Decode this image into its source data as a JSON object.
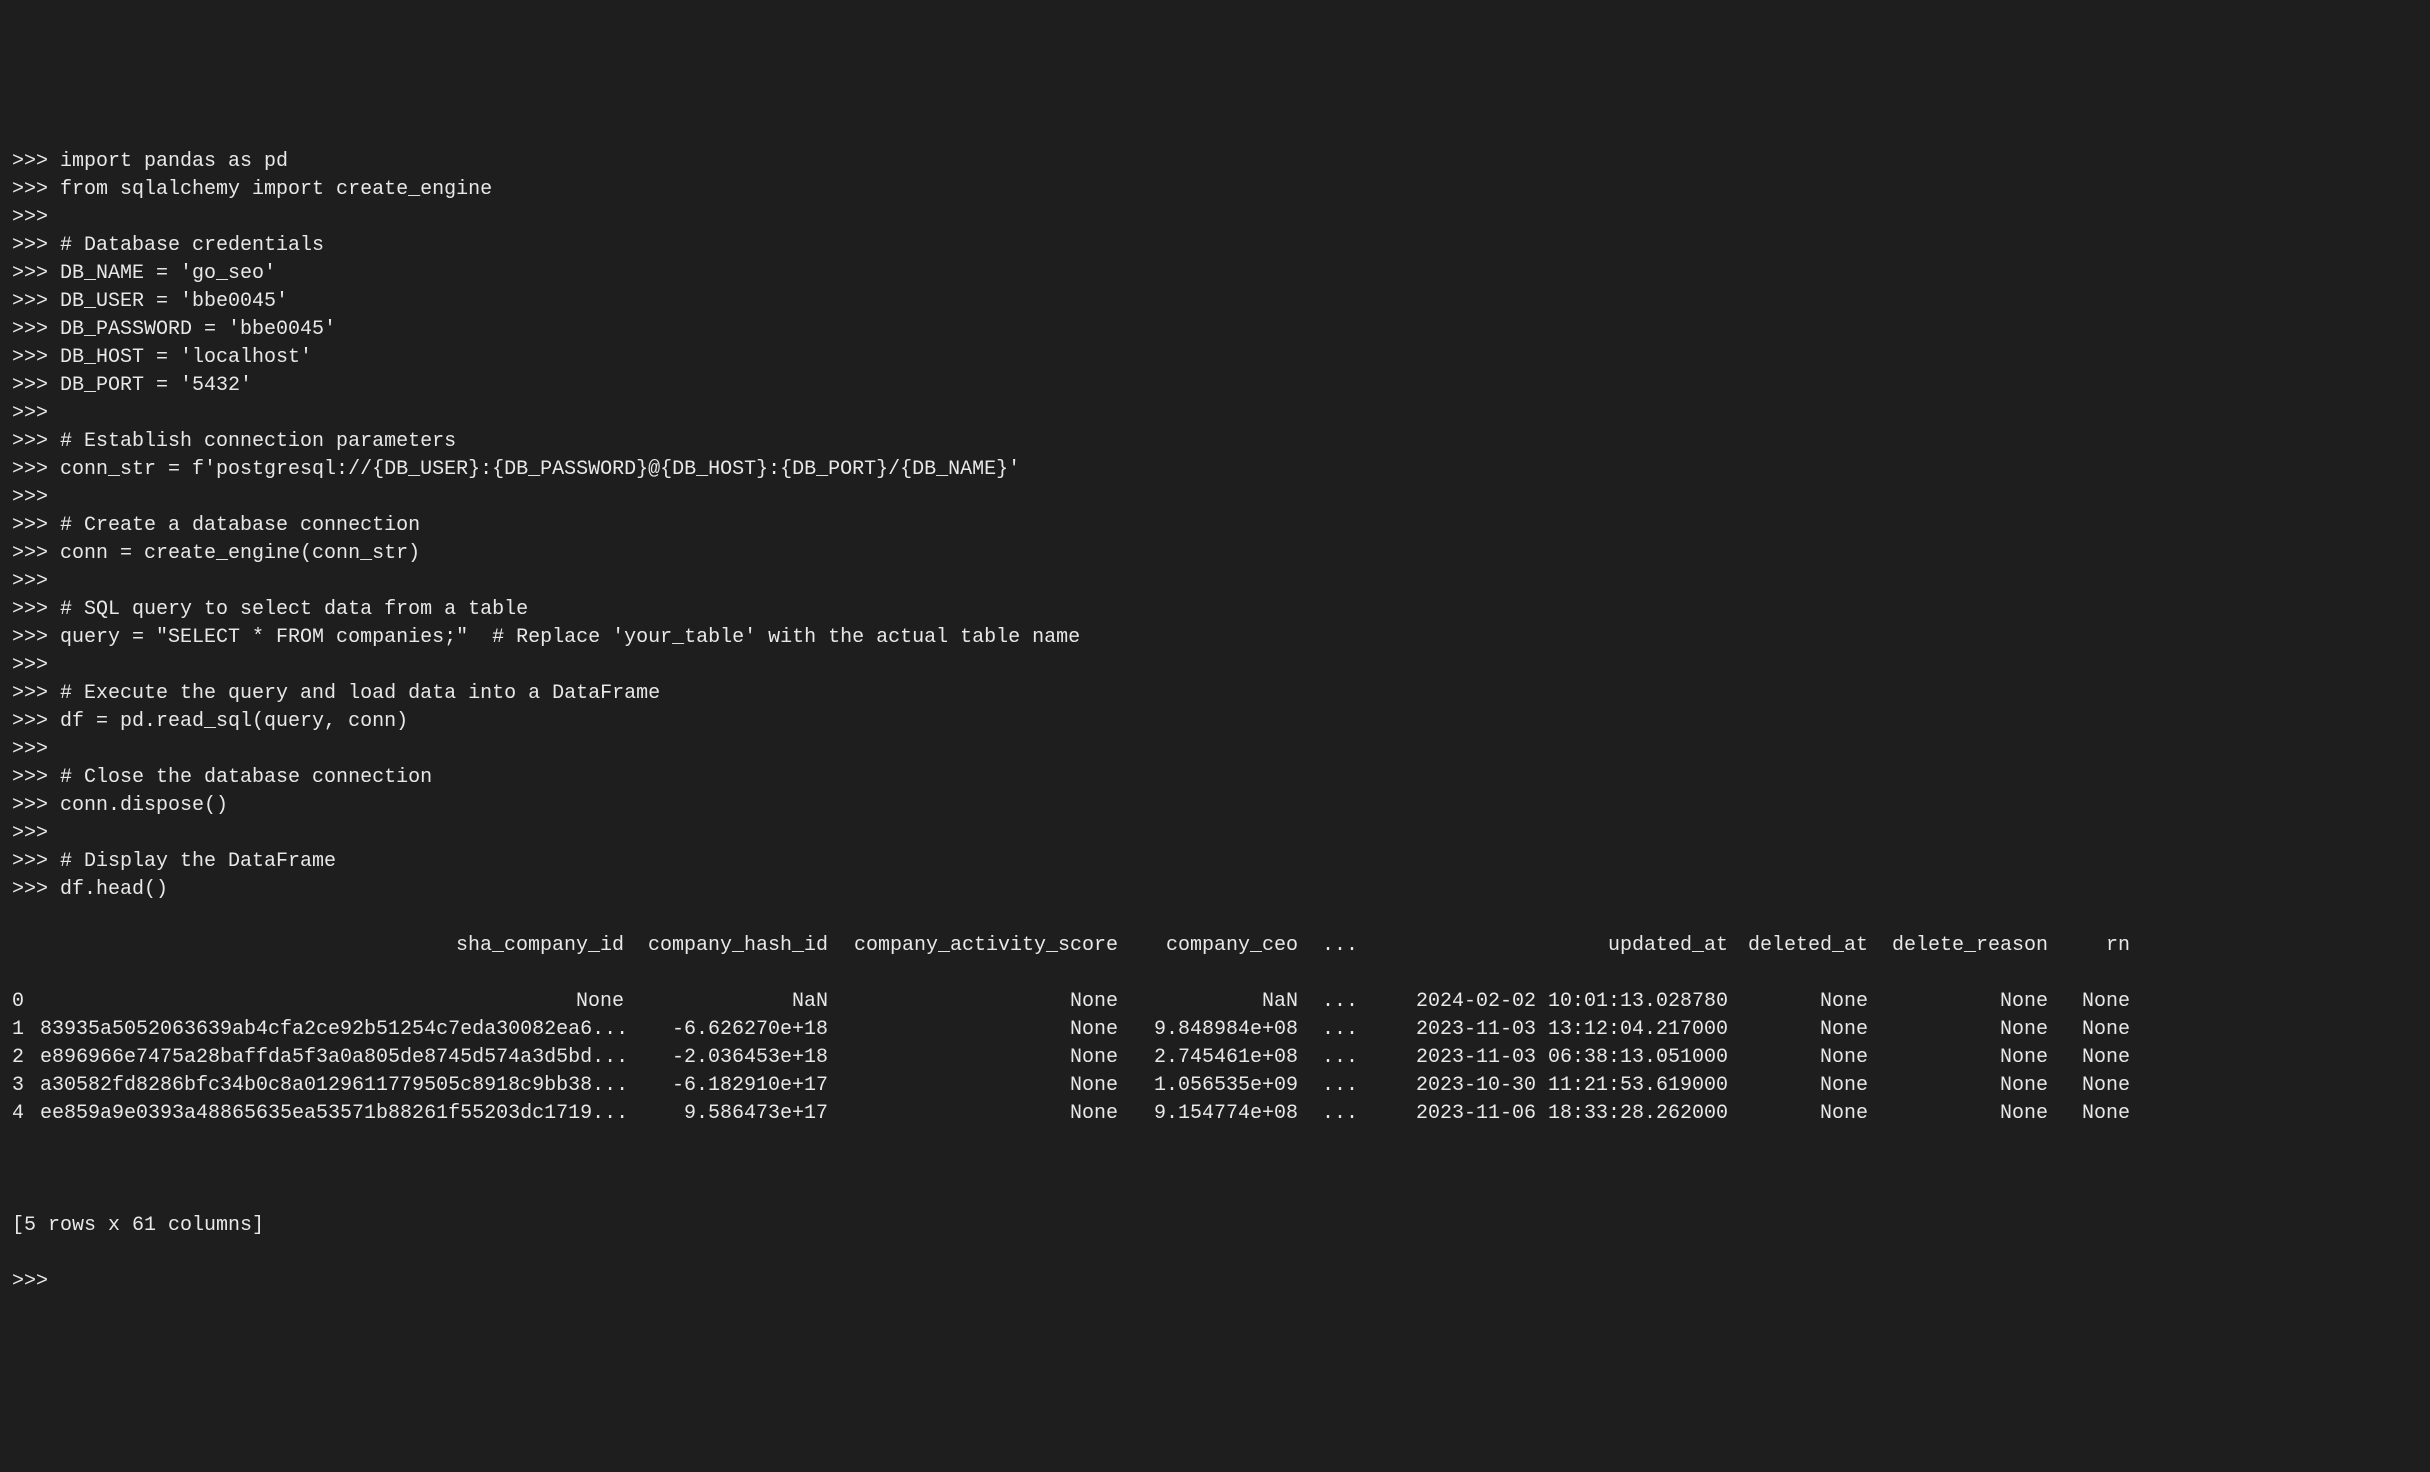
{
  "prompt": ">>> ",
  "code_lines": [
    "import pandas as pd",
    "from sqlalchemy import create_engine",
    "",
    "# Database credentials",
    "DB_NAME = 'go_seo'",
    "DB_USER = 'bbe0045'",
    "DB_PASSWORD = 'bbe0045'",
    "DB_HOST = 'localhost'",
    "DB_PORT = '5432'",
    "",
    "# Establish connection parameters",
    "conn_str = f'postgresql://{DB_USER}:{DB_PASSWORD}@{DB_HOST}:{DB_PORT}/{DB_NAME}'",
    "",
    "# Create a database connection",
    "conn = create_engine(conn_str)",
    "",
    "# SQL query to select data from a table",
    "query = \"SELECT * FROM companies;\"  # Replace 'your_table' with the actual table name",
    "",
    "# Execute the query and load data into a DataFrame",
    "df = pd.read_sql(query, conn)",
    "",
    "# Close the database connection",
    "conn.dispose()",
    "",
    "# Display the DataFrame",
    "df.head()"
  ],
  "table": {
    "headers": {
      "idx": "",
      "sha": "sha_company_id",
      "hash": "company_hash_id",
      "activity": "company_activity_score",
      "ceo": "company_ceo",
      "dots": "...",
      "updated": "updated_at",
      "deleted": "deleted_at",
      "reason": "delete_reason",
      "rn": "rn"
    },
    "rows": [
      {
        "idx": "0",
        "sha": "None",
        "hash": "NaN",
        "activity": "None",
        "ceo": "NaN",
        "dots": "...",
        "updated": "2024-02-02 10:01:13.028780",
        "deleted": "None",
        "reason": "None",
        "rn": "None"
      },
      {
        "idx": "1",
        "sha": "83935a5052063639ab4cfa2ce92b51254c7eda30082ea6...",
        "hash": "-6.626270e+18",
        "activity": "None",
        "ceo": "9.848984e+08",
        "dots": "...",
        "updated": "2023-11-03 13:12:04.217000",
        "deleted": "None",
        "reason": "None",
        "rn": "None"
      },
      {
        "idx": "2",
        "sha": "e896966e7475a28baffda5f3a0a805de8745d574a3d5bd...",
        "hash": "-2.036453e+18",
        "activity": "None",
        "ceo": "2.745461e+08",
        "dots": "...",
        "updated": "2023-11-03 06:38:13.051000",
        "deleted": "None",
        "reason": "None",
        "rn": "None"
      },
      {
        "idx": "3",
        "sha": "a30582fd8286bfc34b0c8a0129611779505c8918c9bb38...",
        "hash": "-6.182910e+17",
        "activity": "None",
        "ceo": "1.056535e+09",
        "dots": "...",
        "updated": "2023-10-30 11:21:53.619000",
        "deleted": "None",
        "reason": "None",
        "rn": "None"
      },
      {
        "idx": "4",
        "sha": "ee859a9e0393a48865635ea53571b88261f55203dc1719...",
        "hash": "9.586473e+17",
        "activity": "None",
        "ceo": "9.154774e+08",
        "dots": "...",
        "updated": "2023-11-06 18:33:28.262000",
        "deleted": "None",
        "reason": "None",
        "rn": "None"
      }
    ]
  },
  "footer": {
    "summary": "[5 rows x 61 columns]",
    "next_prompt": ">>> "
  }
}
